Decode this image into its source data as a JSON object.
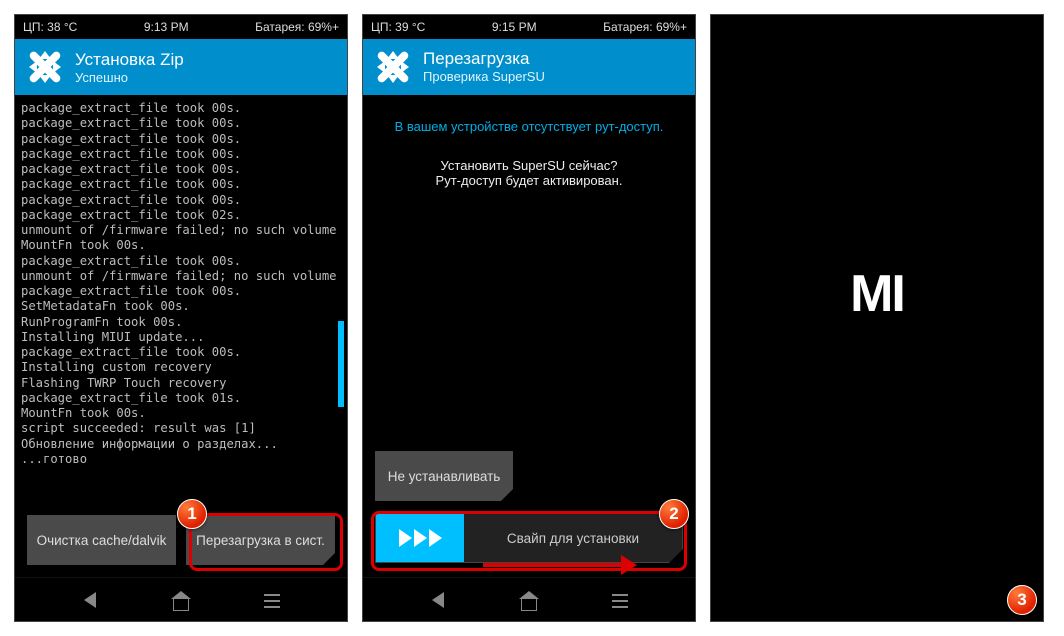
{
  "phone1": {
    "status": {
      "cpu": "ЦП: 38 °C",
      "time": "9:13 PM",
      "battery": "Батарея: 69%+"
    },
    "title": "Установка Zip",
    "subtitle": "Успешно",
    "terminal": "package_extract_file took 00s.\npackage_extract_file took 00s.\npackage_extract_file took 00s.\npackage_extract_file took 00s.\npackage_extract_file took 00s.\npackage_extract_file took 00s.\npackage_extract_file took 00s.\npackage_extract_file took 02s.\nunmount of /firmware failed; no such volume\nMountFn took 00s.\npackage_extract_file took 00s.\nunmount of /firmware failed; no such volume\npackage_extract_file took 00s.\nSetMetadataFn took 00s.\nRunProgramFn took 00s.\nInstalling MIUI update...\npackage_extract_file took 00s.\nInstalling custom recovery\nFlashing TWRP Touch recovery\npackage_extract_file took 01s.\nMountFn took 00s.\nscript succeeded: result was [1]\nОбновление информации о разделах...\n...готово",
    "btn_wipe": "Очистка cache/dalvik",
    "btn_reboot": "Перезагрузка в сист."
  },
  "phone2": {
    "status": {
      "cpu": "ЦП: 39 °C",
      "time": "9:15 PM",
      "battery": "Батарея: 69%+"
    },
    "title": "Перезагрузка",
    "subtitle": "Проверика SuperSU",
    "msg_noroot": "В вашем устройстве отсутствует рут-доступ.",
    "msg_q": "Установить SuperSU сейчас?",
    "msg_info": "Рут-доступ будет активирован.",
    "btn_noinstall": "Не устанавливать",
    "swipe_label": "Свайп для установки"
  },
  "badges": {
    "b1": "1",
    "b2": "2",
    "b3": "3"
  },
  "mi": "MI"
}
